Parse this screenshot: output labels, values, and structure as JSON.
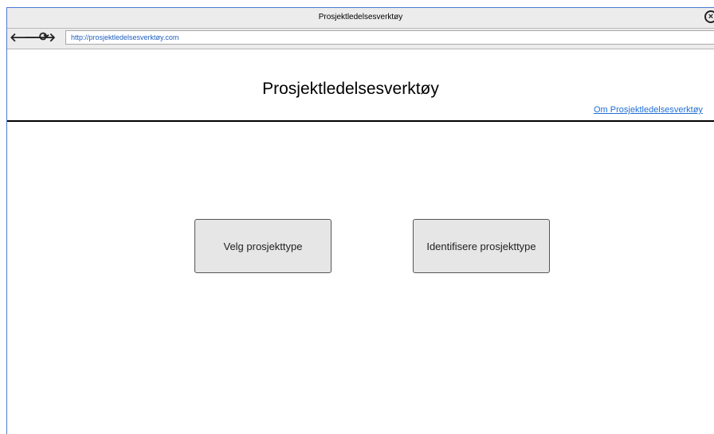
{
  "window": {
    "title": "Prosjektledelsesverktøy",
    "close_icon": "close-icon"
  },
  "addressbar": {
    "url": "http://prosjektledelsesverktøy.com",
    "back_icon": "arrow-left-icon",
    "forward_icon": "arrow-right-icon",
    "reload_icon": "reload-icon"
  },
  "header": {
    "title": "Prosjektledelsesverktøy",
    "about_link": "Om Prosjektledelsesverktøy"
  },
  "main": {
    "buttons": [
      {
        "label": "Velg prosjekttype"
      },
      {
        "label": "Identifisere prosjekttype"
      }
    ]
  },
  "colors": {
    "link": "#1f6fd6",
    "button_bg": "#e6e6e6",
    "chrome_bg": "#ececec",
    "window_edge": "#4a7bd0"
  }
}
